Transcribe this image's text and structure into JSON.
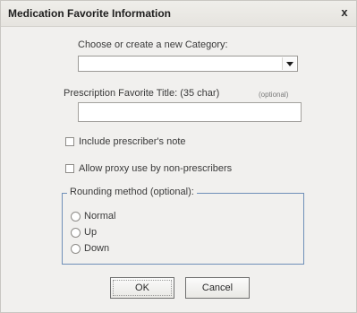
{
  "window": {
    "title": "Medication Favorite Information",
    "close_glyph": "x"
  },
  "category": {
    "label": "Choose or create a new Category:",
    "selected": ""
  },
  "title_field": {
    "label": "Prescription Favorite Title:  (35 char)",
    "optional_note": "(optional)",
    "value": ""
  },
  "options": {
    "include_note": {
      "label": "Include prescriber's note",
      "checked": false
    },
    "allow_proxy": {
      "label": "Allow proxy use by non-prescribers",
      "checked": false
    }
  },
  "rounding": {
    "legend": "Rounding method (optional):",
    "choices": [
      {
        "label": "Normal",
        "selected": false
      },
      {
        "label": "Up",
        "selected": false
      },
      {
        "label": "Down",
        "selected": false
      }
    ]
  },
  "buttons": {
    "ok": "OK",
    "cancel": "Cancel"
  },
  "icons": {
    "dropdown": "chevron-down-icon",
    "close": "close-icon"
  }
}
